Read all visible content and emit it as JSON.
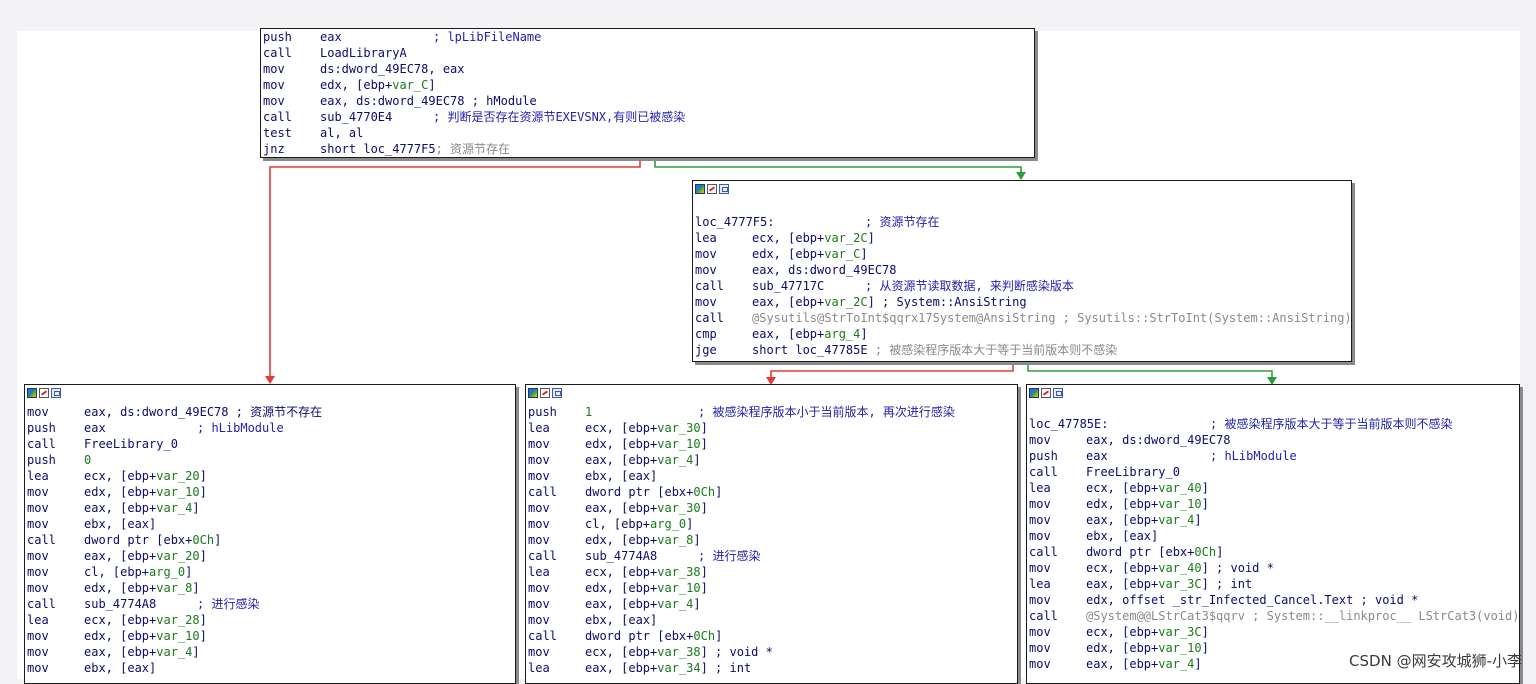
{
  "top_block": {
    "lines": [
      {
        "mn": "push",
        "op": "eax",
        "cm": "; lpLibFileName"
      },
      {
        "mn": "call",
        "op": "LoadLibraryA"
      },
      {
        "mn": "mov",
        "op": "ds:dword_49EC78, eax"
      },
      {
        "mn": "mov",
        "op": "edx, [ebp+",
        "var": "var_C",
        "op2": "]"
      },
      {
        "mn": "mov",
        "op": "eax, ds:dword_49EC78 ; hModule"
      },
      {
        "mn": "call",
        "op": "sub_4770E4",
        "cm": "; 判断是否存在资源节EXEVSNX,有则已被感染"
      },
      {
        "mn": "test",
        "op": "al, al"
      },
      {
        "mn": "jnz",
        "op": "short loc_4777F5",
        "g": "; 资源节存在"
      }
    ]
  },
  "mid_block": {
    "label": "loc_4777F5:",
    "label_comment": "; 资源节存在",
    "lines": [
      {
        "mn": "lea",
        "op": "ecx, [ebp+",
        "var": "var_2C",
        "op2": "]"
      },
      {
        "mn": "mov",
        "op": "edx, [ebp+",
        "var": "var_C",
        "op2": "]"
      },
      {
        "mn": "mov",
        "op": "eax, ds:dword_49EC78"
      },
      {
        "mn": "call",
        "op": "sub_47717C",
        "cm": "; 从资源节读取数据, 来判断感染版本"
      },
      {
        "mn": "mov",
        "op": "eax, [ebp+",
        "var": "var_2C",
        "op2": "] ; System::AnsiString"
      },
      {
        "mn": "call",
        "op": "",
        "g": "@Sysutils@StrToInt$qqrx17System@AnsiString",
        "g2": " ; Sysutils::StrToInt(System::AnsiString)"
      },
      {
        "mn": "cmp",
        "op": "eax, [ebp+",
        "var": "arg_4",
        "op2": "]"
      },
      {
        "mn": "jge",
        "op": "short loc_47785E",
        "g": " ; 被感染程序版本大于等于当前版本则不感染"
      }
    ]
  },
  "left_block": {
    "lines": [
      {
        "mn": "mov",
        "op": "eax, ds:dword_49EC78 ; 资源节不存在"
      },
      {
        "mn": "push",
        "op": "eax",
        "cm": "; hLibModule"
      },
      {
        "mn": "call",
        "op": "FreeLibrary_0"
      },
      {
        "mn": "push",
        "op": "",
        "gn": "0"
      },
      {
        "mn": "lea",
        "op": "ecx, [ebp+",
        "var": "var_20",
        "op2": "]"
      },
      {
        "mn": "mov",
        "op": "edx, [ebp+",
        "var": "var_10",
        "op2": "]"
      },
      {
        "mn": "mov",
        "op": "eax, [ebp+",
        "var": "var_4",
        "op2": "]"
      },
      {
        "mn": "mov",
        "op": "ebx, [eax]"
      },
      {
        "mn": "call",
        "op": "dword ptr [ebx+",
        "var": "0Ch",
        "op2": "]"
      },
      {
        "mn": "mov",
        "op": "eax, [ebp+",
        "var": "var_20",
        "op2": "]"
      },
      {
        "mn": "mov",
        "op": "cl, [ebp+",
        "var": "arg_0",
        "op2": "]"
      },
      {
        "mn": "mov",
        "op": "edx, [ebp+",
        "var": "var_8",
        "op2": "]"
      },
      {
        "mn": "call",
        "op": "sub_4774A8",
        "cm": "; 进行感染"
      },
      {
        "mn": "lea",
        "op": "ecx, [ebp+",
        "var": "var_28",
        "op2": "]"
      },
      {
        "mn": "mov",
        "op": "edx, [ebp+",
        "var": "var_10",
        "op2": "]"
      },
      {
        "mn": "mov",
        "op": "eax, [ebp+",
        "var": "var_4",
        "op2": "]"
      },
      {
        "mn": "mov",
        "op": "ebx, [eax]"
      }
    ]
  },
  "center_block": {
    "lines": [
      {
        "mn": "push",
        "op": "",
        "gn": "1",
        "cm": "; 被感染程序版本小于当前版本, 再次进行感染"
      },
      {
        "mn": "lea",
        "op": "ecx, [ebp+",
        "var": "var_30",
        "op2": "]"
      },
      {
        "mn": "mov",
        "op": "edx, [ebp+",
        "var": "var_10",
        "op2": "]"
      },
      {
        "mn": "mov",
        "op": "eax, [ebp+",
        "var": "var_4",
        "op2": "]"
      },
      {
        "mn": "mov",
        "op": "ebx, [eax]"
      },
      {
        "mn": "call",
        "op": "dword ptr [ebx+",
        "var": "0Ch",
        "op2": "]"
      },
      {
        "mn": "mov",
        "op": "eax, [ebp+",
        "var": "var_30",
        "op2": "]"
      },
      {
        "mn": "mov",
        "op": "cl, [ebp+",
        "var": "arg_0",
        "op2": "]"
      },
      {
        "mn": "mov",
        "op": "edx, [ebp+",
        "var": "var_8",
        "op2": "]"
      },
      {
        "mn": "call",
        "op": "sub_4774A8",
        "cm": "; 进行感染"
      },
      {
        "mn": "lea",
        "op": "ecx, [ebp+",
        "var": "var_38",
        "op2": "]"
      },
      {
        "mn": "mov",
        "op": "edx, [ebp+",
        "var": "var_10",
        "op2": "]"
      },
      {
        "mn": "mov",
        "op": "eax, [ebp+",
        "var": "var_4",
        "op2": "]"
      },
      {
        "mn": "mov",
        "op": "ebx, [eax]"
      },
      {
        "mn": "call",
        "op": "dword ptr [ebx+",
        "var": "0Ch",
        "op2": "]"
      },
      {
        "mn": "mov",
        "op": "ecx, [ebp+",
        "var": "var_38",
        "op2": "] ; void *"
      },
      {
        "mn": "lea",
        "op": "eax, [ebp+",
        "var": "var_34",
        "op2": "] ; int"
      }
    ]
  },
  "right_block": {
    "label": "loc_47785E:",
    "label_comment": "; 被感染程序版本大于等于当前版本则不感染",
    "lines": [
      {
        "mn": "mov",
        "op": "eax, ds:dword_49EC78"
      },
      {
        "mn": "push",
        "op": "eax",
        "cm": "; hLibModule"
      },
      {
        "mn": "call",
        "op": "FreeLibrary_0"
      },
      {
        "mn": "lea",
        "op": "ecx, [ebp+",
        "var": "var_40",
        "op2": "]"
      },
      {
        "mn": "mov",
        "op": "edx, [ebp+",
        "var": "var_10",
        "op2": "]"
      },
      {
        "mn": "mov",
        "op": "eax, [ebp+",
        "var": "var_4",
        "op2": "]"
      },
      {
        "mn": "mov",
        "op": "ebx, [eax]"
      },
      {
        "mn": "call",
        "op": "dword ptr [ebx+",
        "var": "0Ch",
        "op2": "]"
      },
      {
        "mn": "mov",
        "op": "ecx, [ebp+",
        "var": "var_40",
        "op2": "] ; void *"
      },
      {
        "mn": "lea",
        "op": "eax, [ebp+",
        "var": "var_3C",
        "op2": "] ; int"
      },
      {
        "mn": "mov",
        "op": "edx, offset _str_Infected_Cancel.Text ; void *"
      },
      {
        "mn": "call",
        "op": "",
        "g": "@System@@LStrCat3$qqrv",
        "g2": " ; System::__linkproc__ LStrCat3(void)"
      },
      {
        "mn": "mov",
        "op": "ecx, [ebp+",
        "var": "var_3C",
        "op2": "]"
      },
      {
        "mn": "mov",
        "op": "edx, [ebp+",
        "var": "var_10",
        "op2": "]"
      },
      {
        "mn": "mov",
        "op": "eax, [ebp+",
        "var": "var_4",
        "op2": "]"
      }
    ]
  },
  "watermark": "CSDN @网安攻城狮-小李",
  "colors": {
    "false_edge": "#e53935",
    "true_edge": "#2e9e3c"
  }
}
